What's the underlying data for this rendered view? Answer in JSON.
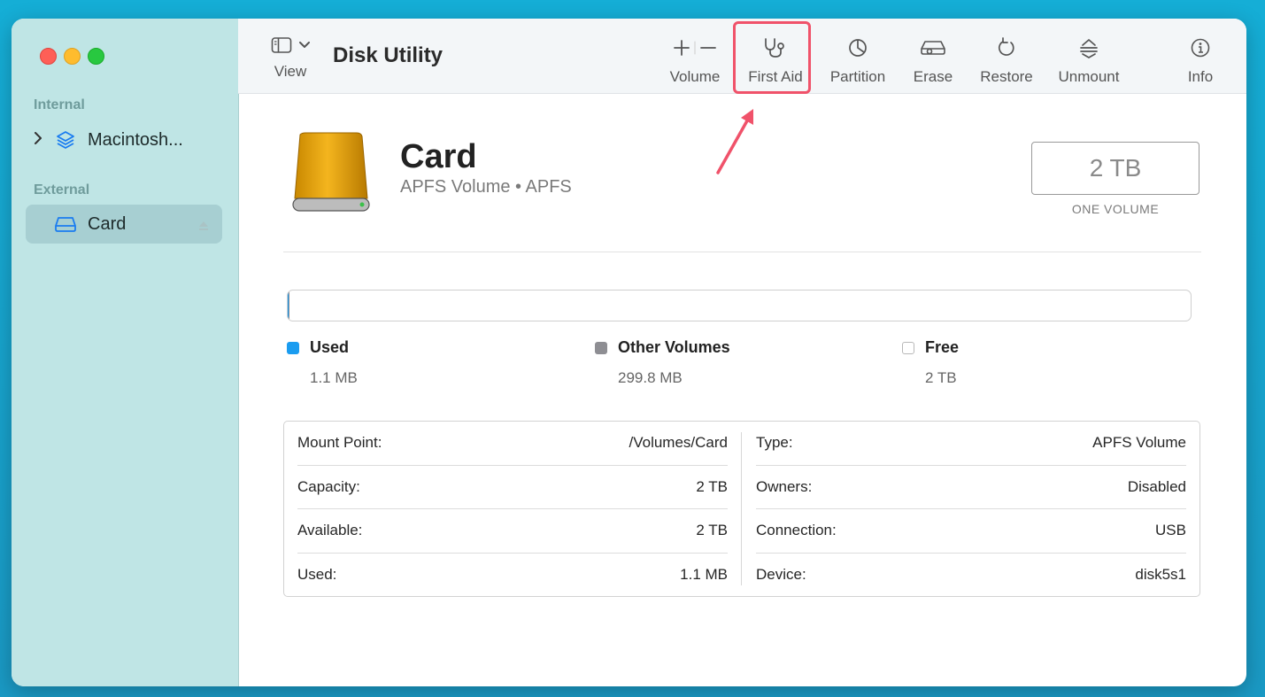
{
  "app": {
    "title": "Disk Utility"
  },
  "toolbar": {
    "view_label": "View",
    "buttons": [
      {
        "label": "Volume",
        "icon": "plus-minus-icon"
      },
      {
        "label": "First Aid",
        "icon": "stethoscope-icon"
      },
      {
        "label": "Partition",
        "icon": "pie-chart-icon"
      },
      {
        "label": "Erase",
        "icon": "erase-drive-icon"
      },
      {
        "label": "Restore",
        "icon": "restore-arrow-icon"
      },
      {
        "label": "Unmount",
        "icon": "unmount-icon"
      },
      {
        "label": "Info",
        "icon": "info-icon"
      }
    ],
    "highlighted": "First Aid"
  },
  "sidebar": {
    "sections": [
      {
        "title": "Internal",
        "items": [
          {
            "label": "Macintosh...",
            "icon": "layers-icon",
            "expandable": true
          }
        ]
      },
      {
        "title": "External",
        "items": [
          {
            "label": "Card",
            "icon": "external-drive-icon",
            "selected": true,
            "ejectable": true
          }
        ]
      }
    ]
  },
  "volume": {
    "name": "Card",
    "subtitle": "APFS Volume • APFS",
    "capacity": "2 TB",
    "capacity_label": "ONE VOLUME"
  },
  "usage": {
    "legend": [
      {
        "label": "Used",
        "value": "1.1 MB",
        "color": "#1a9cf0"
      },
      {
        "label": "Other Volumes",
        "value": "299.8 MB",
        "color": "#8e8e93"
      },
      {
        "label": "Free",
        "value": "2 TB",
        "color": "#ffffff"
      }
    ]
  },
  "info": {
    "left": [
      {
        "key": "Mount Point:",
        "value": "/Volumes/Card"
      },
      {
        "key": "Capacity:",
        "value": "2 TB"
      },
      {
        "key": "Available:",
        "value": "2 TB"
      },
      {
        "key": "Used:",
        "value": "1.1 MB"
      }
    ],
    "right": [
      {
        "key": "Type:",
        "value": "APFS Volume"
      },
      {
        "key": "Owners:",
        "value": "Disabled"
      },
      {
        "key": "Connection:",
        "value": "USB"
      },
      {
        "key": "Device:",
        "value": "disk5s1"
      }
    ]
  },
  "colors": {
    "sidebar_bg": "#bfe5e5",
    "accent": "#1a7cf0",
    "highlight": "#f0526a"
  }
}
